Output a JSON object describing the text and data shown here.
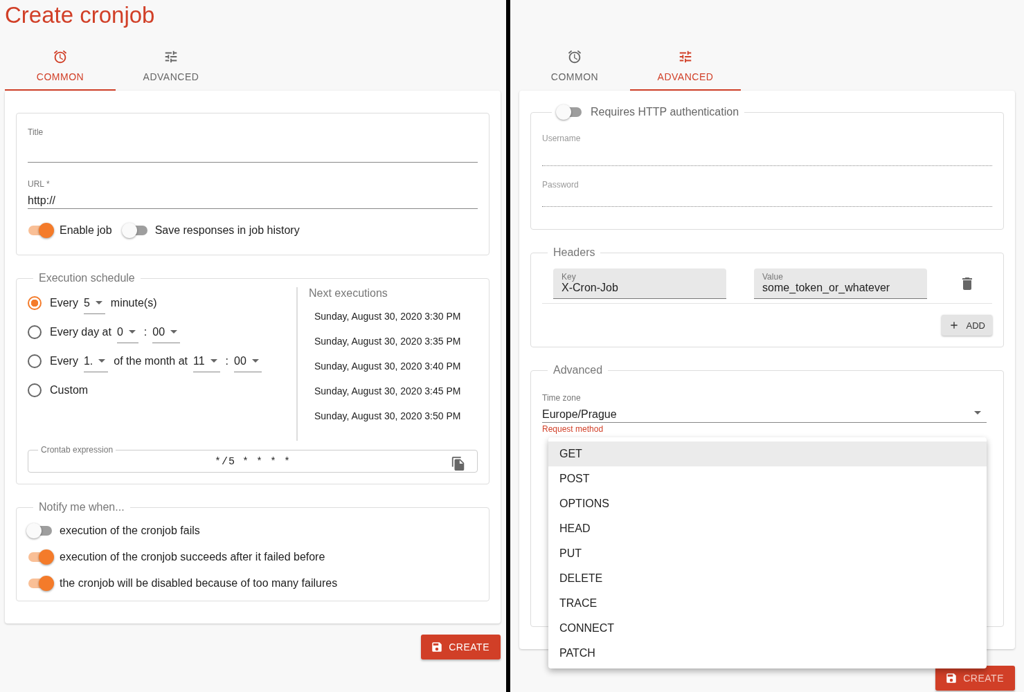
{
  "left": {
    "title": "Create cronjob",
    "tabs": [
      {
        "label": "COMMON",
        "selected": true
      },
      {
        "label": "ADVANCED",
        "selected": false
      }
    ],
    "fields": [
      {
        "label": "Title"
      },
      {
        "label": "URL *",
        "value": "http://"
      }
    ],
    "toggles": [
      {
        "label": "Enable job",
        "on": true
      },
      {
        "label": "Save responses in job history",
        "on": false
      }
    ],
    "schedule": {
      "legend": "Execution schedule",
      "options": [
        {
          "selected": true,
          "parts": [
            {
              "kind": "text",
              "text": "Every"
            },
            {
              "kind": "select",
              "value": "5"
            },
            {
              "kind": "text",
              "text": "minute(s)"
            }
          ]
        },
        {
          "selected": false,
          "parts": [
            {
              "kind": "text",
              "text": "Every day at"
            },
            {
              "kind": "select",
              "value": "0"
            },
            {
              "kind": "text",
              "text": ":"
            },
            {
              "kind": "select",
              "value": "00"
            }
          ]
        },
        {
          "selected": false,
          "parts": [
            {
              "kind": "text",
              "text": "Every"
            },
            {
              "kind": "select",
              "value": "1."
            },
            {
              "kind": "text",
              "text": "of the month at"
            },
            {
              "kind": "select",
              "value": "11"
            },
            {
              "kind": "text",
              "text": ":"
            },
            {
              "kind": "select",
              "value": "00"
            }
          ]
        },
        {
          "selected": false,
          "parts": [
            {
              "kind": "text",
              "text": "Custom"
            }
          ]
        }
      ],
      "next_title": "Next executions",
      "next": [
        "Sunday, August 30, 2020 3:30 PM",
        "Sunday, August 30, 2020 3:35 PM",
        "Sunday, August 30, 2020 3:40 PM",
        "Sunday, August 30, 2020 3:45 PM",
        "Sunday, August 30, 2020 3:50 PM"
      ],
      "crontab": {
        "label": "Crontab expression",
        "value": "*/5 * * * *"
      }
    },
    "notify": {
      "legend": "Notify me when...",
      "toggles": [
        {
          "label": "execution of the cronjob fails",
          "on": false
        },
        {
          "label": "execution of the cronjob succeeds after it failed before",
          "on": true
        },
        {
          "label": "the cronjob will be disabled because of too many failures",
          "on": true
        }
      ]
    },
    "create_button": "CREATE"
  },
  "right": {
    "tabs": [
      {
        "label": "COMMON",
        "selected": false
      },
      {
        "label": "ADVANCED",
        "selected": true
      }
    ],
    "auth": {
      "label": "Requires HTTP authentication",
      "on": false,
      "fields": [
        {
          "label": "Username",
          "disabled": true
        },
        {
          "label": "Password",
          "disabled": true
        }
      ]
    },
    "headers": {
      "legend": "Headers",
      "rows": [
        {
          "key_label": "Key",
          "key": "X-Cron-Job",
          "value_label": "Value",
          "value": "some_token_or_whatever"
        }
      ],
      "add_button": "ADD"
    },
    "advanced": {
      "legend": "Advanced",
      "timezone_label": "Time zone",
      "timezone": "Europe/Prague",
      "method_label": "Request method"
    },
    "method_menu": [
      {
        "label": "GET",
        "selected": true
      },
      {
        "label": "POST",
        "selected": false
      },
      {
        "label": "OPTIONS",
        "selected": false
      },
      {
        "label": "HEAD",
        "selected": false
      },
      {
        "label": "PUT",
        "selected": false
      },
      {
        "label": "DELETE",
        "selected": false
      },
      {
        "label": "TRACE",
        "selected": false
      },
      {
        "label": "CONNECT",
        "selected": false
      },
      {
        "label": "PATCH",
        "selected": false
      }
    ],
    "create_button": "CREATE"
  }
}
